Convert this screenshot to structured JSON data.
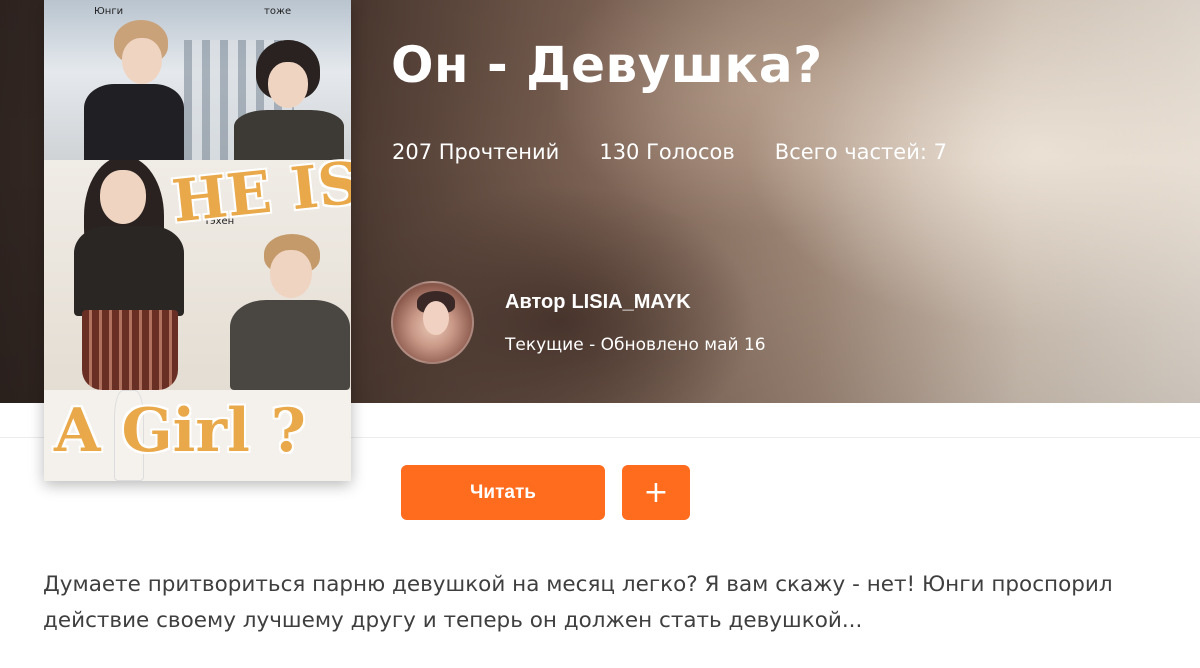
{
  "story": {
    "title": "Он - Девушка?",
    "stats": {
      "reads": "207 Прочтений",
      "votes": "130 Голосов",
      "parts": "Всего частей: 7"
    },
    "author": {
      "prefix": "Автор",
      "name": "LISIA_MAYK",
      "status": "Текущие - Обновлено май 16"
    },
    "description": "Думаете притвориться парню девушкой на месяц легко? Я вам скажу - нет! Юнги проспорил действие своему лучшему другу и теперь он должен стать девушкой..."
  },
  "cover": {
    "title_top": "HE IS",
    "title_bottom": "A Girl ?",
    "notes": [
      "Юнги",
      "тоже",
      "Юнги",
      "Тэхён"
    ]
  },
  "actions": {
    "read_label": "Читать",
    "add_label": "+"
  },
  "colors": {
    "accent": "#ff6c1e",
    "text_dark": "#3f3f3f",
    "on_hero": "#ffffff"
  },
  "icons": {
    "add": "plus-icon"
  }
}
